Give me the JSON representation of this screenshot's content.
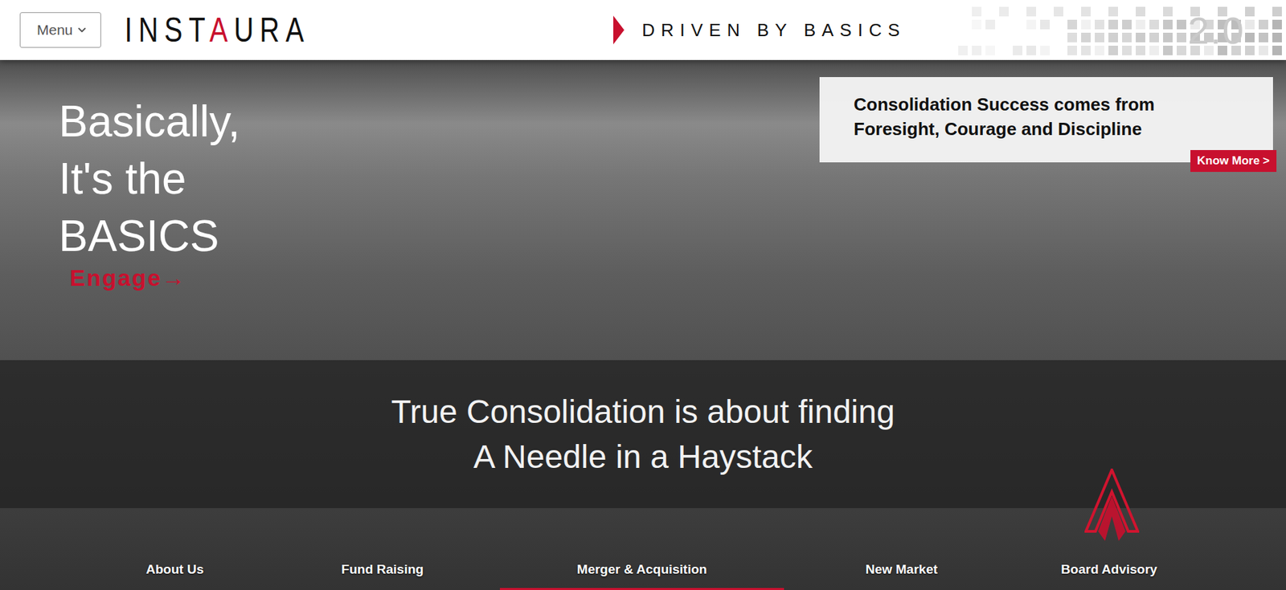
{
  "header": {
    "menu": "Menu",
    "logo": {
      "before": "INST",
      "accent": "A",
      "after": "URA"
    },
    "tagline": "DRIVEN BY BASICS",
    "version": "2.0"
  },
  "hero": {
    "headline": [
      "Basically,",
      "It's the",
      "BASICS"
    ],
    "cta": "Engage→",
    "card": {
      "text": [
        "Consolidation Success comes from",
        "Foresight, Courage and Discipline"
      ],
      "button": "Know More >"
    },
    "banner": [
      "True Consolidation is about finding",
      "A Needle in a Haystack"
    ]
  },
  "nav": [
    {
      "label": "About Us",
      "selected": false
    },
    {
      "label": "Fund Raising",
      "selected": false
    },
    {
      "label": "Merger & Acquisition",
      "selected": true
    },
    {
      "label": "New Market",
      "selected": false
    },
    {
      "label": "Board Advisory",
      "selected": false
    }
  ]
}
